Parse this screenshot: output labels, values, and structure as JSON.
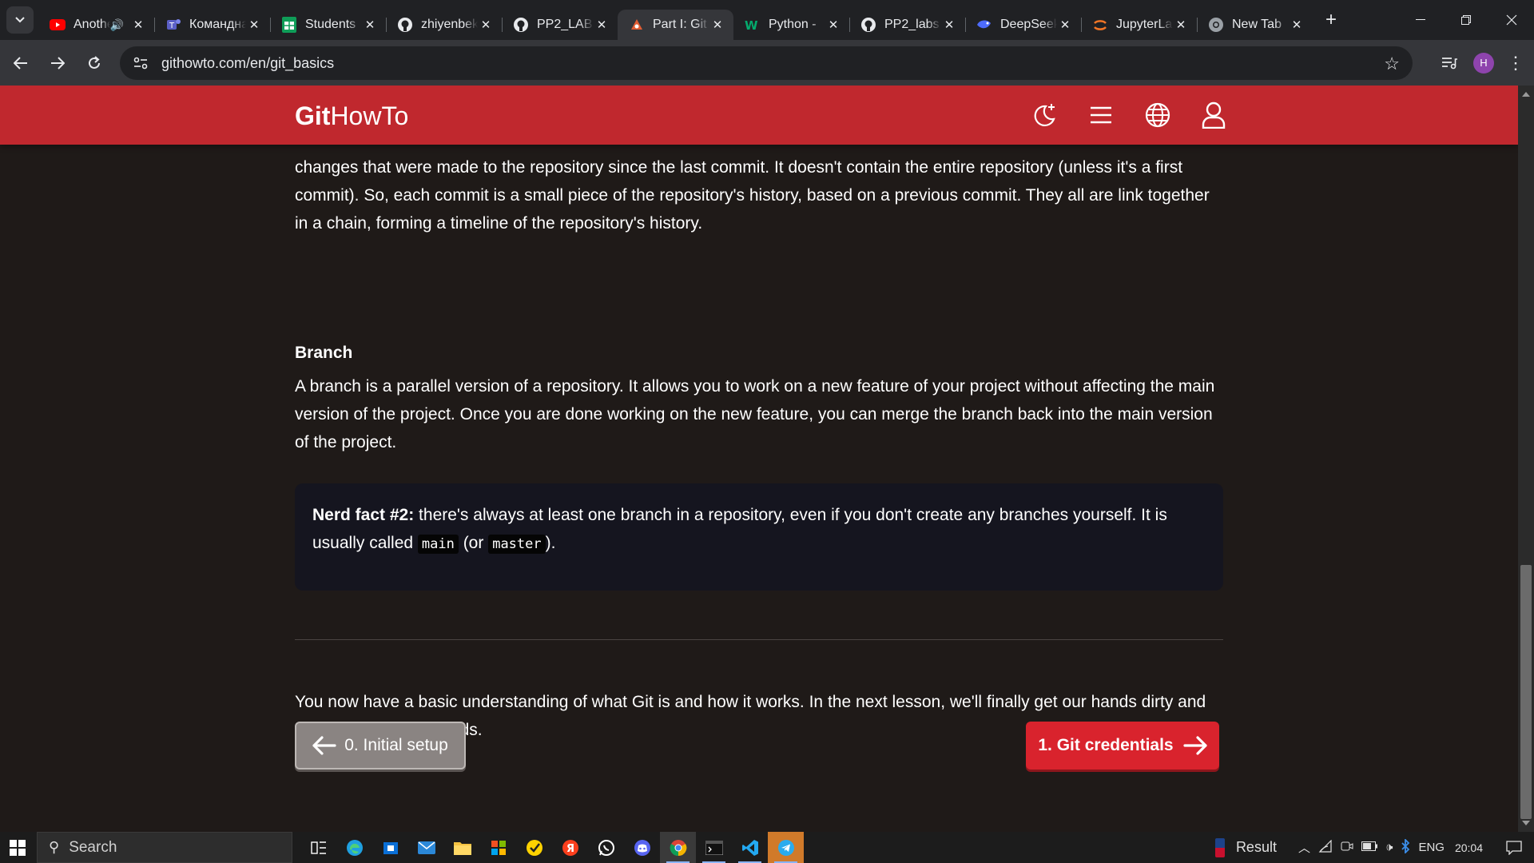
{
  "browser": {
    "tabs": [
      {
        "title": "Another",
        "icon": "youtube-icon",
        "audio": true,
        "active": false
      },
      {
        "title": "Командная",
        "icon": "teams-icon",
        "active": false
      },
      {
        "title": "Students",
        "icon": "sheets-icon",
        "active": false
      },
      {
        "title": "zhiyenbek",
        "icon": "github-icon",
        "active": false
      },
      {
        "title": "PP2_LAB",
        "icon": "github-icon",
        "active": false
      },
      {
        "title": "Part I: Git",
        "icon": "githowto-icon",
        "active": true
      },
      {
        "title": "Python -",
        "icon": "w3schools-icon",
        "active": false
      },
      {
        "title": "PP2_labs",
        "icon": "github-icon",
        "active": false
      },
      {
        "title": "DeepSeek",
        "icon": "deepseek-icon",
        "active": false
      },
      {
        "title": "JupyterLab",
        "icon": "jupyter-icon",
        "active": false
      },
      {
        "title": "New Tab",
        "icon": "chrome-icon",
        "active": false
      }
    ],
    "url": "githowto.com/en/git_basics",
    "profile_initial": "H"
  },
  "site": {
    "logo_bold": "Git",
    "logo_rest": "HowTo"
  },
  "article": {
    "para_commit": "changes that were made to the repository since the last commit. It doesn't contain the entire repository (unless it's a first commit). So, each commit is a small piece of the repository's history, based on a previous commit. They all are link together in a chain, forming a timeline of the repository's history.",
    "heading_branch": "Branch",
    "para_branch": "A branch is a parallel version of a repository. It allows you to work on a new feature of your project without affecting the main version of the project. Once you are done working on the new feature, you can merge the branch back into the main version of the project.",
    "nerd_label": "Nerd fact #2:",
    "nerd_text_1": " there's always at least one branch in a repository, even if you don't create any branches yourself. It is usually called ",
    "nerd_code_1": "main",
    "nerd_text_2": " (or ",
    "nerd_code_2": "master",
    "nerd_text_3": ").",
    "para_summary": "You now have a basic understanding of what Git is and how it works. In the next lesson, we'll finally get our hands dirty and run some Git commands."
  },
  "navigation": {
    "prev_label": "0. Initial setup",
    "next_label": "1. Git credentials"
  },
  "taskbar": {
    "search_placeholder": "Search",
    "news_label": "Result",
    "language": "ENG",
    "time": "20:04"
  }
}
